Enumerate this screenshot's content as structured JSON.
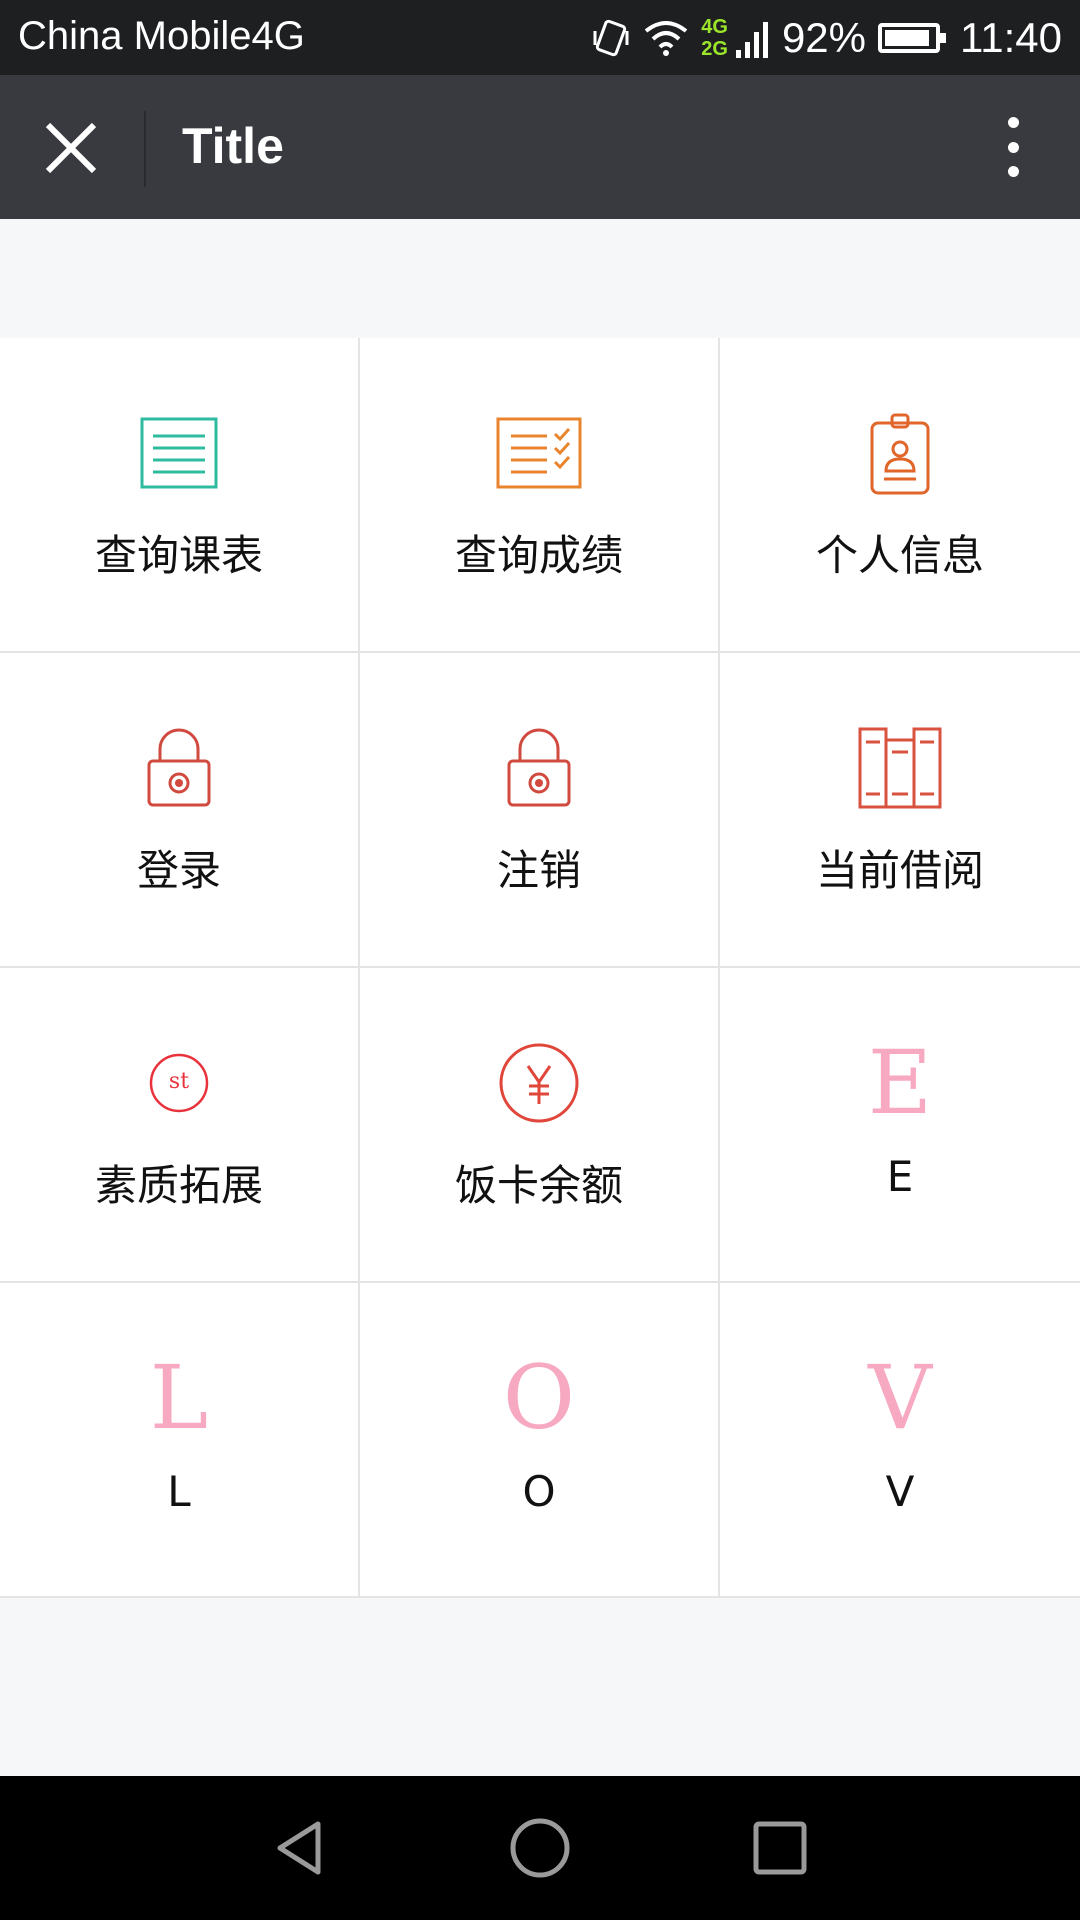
{
  "status_bar": {
    "carrier": "China Mobile4G",
    "net_top": "4G",
    "net_bottom": "2G",
    "battery": "92%",
    "battery_level": 0.92,
    "time": "11:40"
  },
  "app_bar": {
    "title": "Title"
  },
  "grid": {
    "items": [
      {
        "label": "查询课表",
        "icon": "schedule-list-icon",
        "color": "#2ebba0"
      },
      {
        "label": "查询成绩",
        "icon": "grade-checklist-icon",
        "color": "#e8842c"
      },
      {
        "label": "个人信息",
        "icon": "id-badge-icon",
        "color": "#e0662a"
      },
      {
        "label": "登录",
        "icon": "lock-icon",
        "color": "#d14a3f"
      },
      {
        "label": "注销",
        "icon": "lock-icon",
        "color": "#d14a3f"
      },
      {
        "label": "当前借阅",
        "icon": "books-icon",
        "color": "#d9523e"
      },
      {
        "label": "素质拓展",
        "icon": "st-circle-icon",
        "color": "#e8323c"
      },
      {
        "label": "饭卡余额",
        "icon": "yen-circle-icon",
        "color": "#e0473a"
      },
      {
        "label": "E",
        "icon": "letter-e-icon",
        "glyph": "E",
        "color": "#f7a9c2"
      },
      {
        "label": "L",
        "icon": "letter-l-icon",
        "glyph": "L",
        "color": "#f7a9c2"
      },
      {
        "label": "O",
        "icon": "letter-o-icon",
        "glyph": "O",
        "color": "#f7a9c2"
      },
      {
        "label": "V",
        "icon": "letter-v-icon",
        "glyph": "V",
        "color": "#f7a9c2"
      }
    ]
  }
}
